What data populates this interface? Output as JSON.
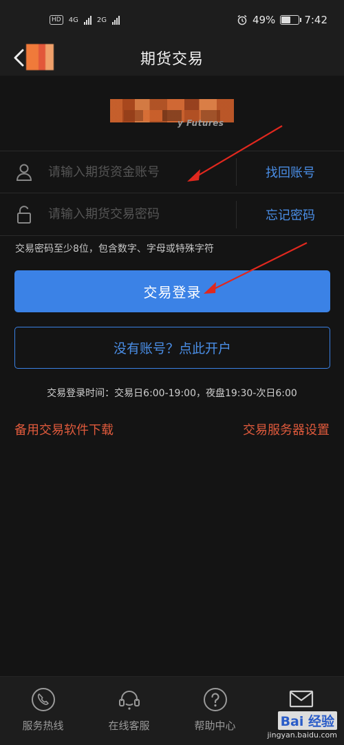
{
  "status_bar": {
    "network_badge": "HD",
    "net_4g": "4G",
    "net_2g": "2G",
    "battery_percent": "49%",
    "battery_level": 0.49,
    "time": "7:42"
  },
  "header": {
    "title": "期货交易",
    "back_icon": "chevron-left-icon"
  },
  "brand": {
    "subtitle": "y Futures"
  },
  "form": {
    "account": {
      "placeholder": "请输入期货资金账号",
      "link": "找回账号",
      "icon": "user-icon"
    },
    "password": {
      "placeholder": "请输入期货交易密码",
      "link": "忘记密码",
      "icon": "lock-icon"
    },
    "hint": "交易密码至少8位，包含数字、字母或特殊字符"
  },
  "actions": {
    "login": "交易登录",
    "open_account": "没有账号？点此开户",
    "login_time": "交易登录时间：交易日6:00-19:00，夜盘19:30-次日6:00",
    "backup_download": "备用交易软件下载",
    "server_settings": "交易服务器设置"
  },
  "bottom_nav": [
    {
      "label": "服务热线",
      "icon": "phone-icon"
    },
    {
      "label": "在线客服",
      "icon": "headset-icon"
    },
    {
      "label": "帮助中心",
      "icon": "help-icon"
    },
    {
      "label": "",
      "icon": "mail-icon"
    }
  ],
  "watermark": {
    "main": "Bai 经验",
    "sub": "jingyan.baidu.com"
  },
  "colors": {
    "background": "#141414",
    "bar": "#1d1d1d",
    "accent_blue": "#3b82e6",
    "link_blue": "#4a8ee6",
    "link_red": "#e05a3c",
    "annotation_red": "#e0281e"
  }
}
